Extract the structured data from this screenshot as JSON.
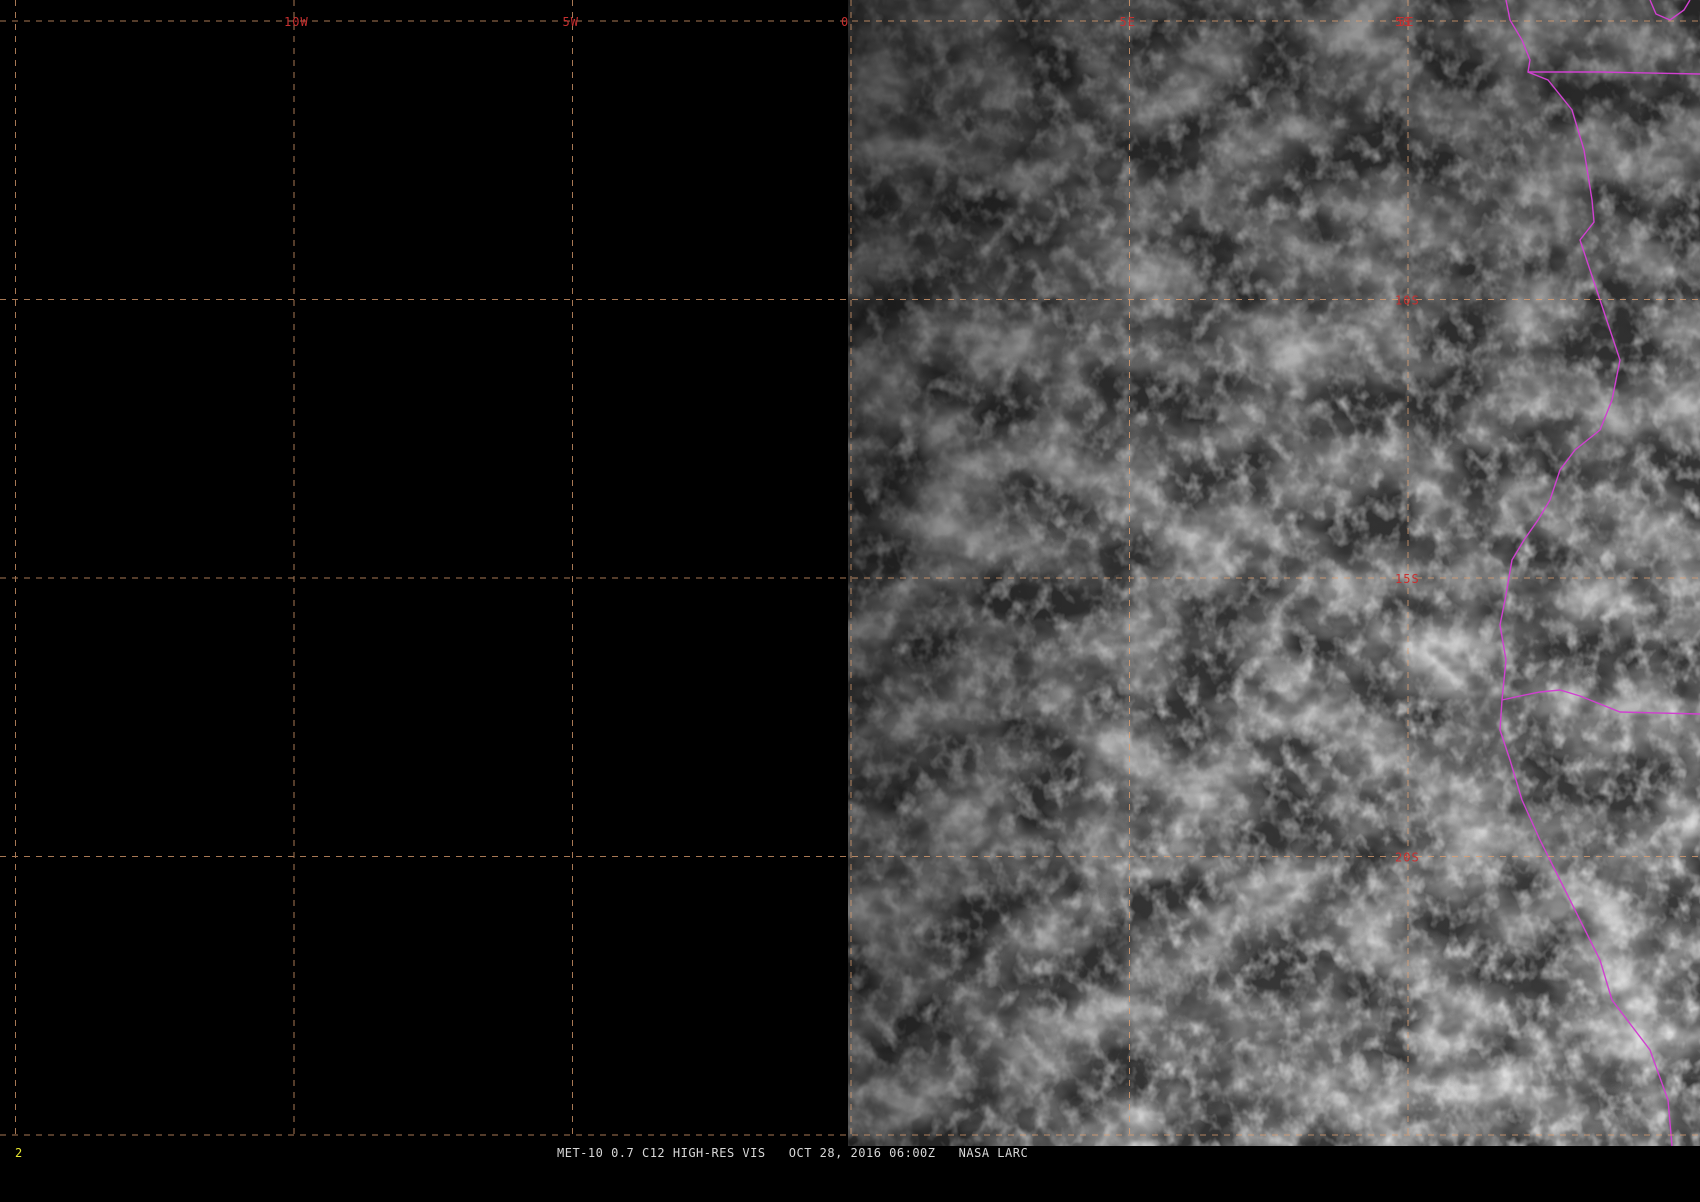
{
  "colors": {
    "grid": "#e0a070",
    "grid_label": "#c83030",
    "border": "#d040d0",
    "background": "#000000"
  },
  "grid": {
    "longitudes": [
      {
        "value": -15,
        "label": ""
      },
      {
        "value": -10,
        "label": "10W"
      },
      {
        "value": -5,
        "label": "5W"
      },
      {
        "value": 0,
        "label": "0"
      },
      {
        "value": 5,
        "label": "5E"
      },
      {
        "value": 10,
        "label": "5E"
      }
    ],
    "latitudes": [
      {
        "value": -5,
        "label": "5S"
      },
      {
        "value": -10,
        "label": "10S"
      },
      {
        "value": -15,
        "label": "15S"
      },
      {
        "value": -20,
        "label": "20S"
      },
      {
        "value": -25,
        "label": ""
      }
    ]
  },
  "status_bar": {
    "frame": "2",
    "caption": "MET-10 0.7 C12 HIGH-RES VIS   OCT 28, 2016 06:00Z   NASA LARC"
  }
}
